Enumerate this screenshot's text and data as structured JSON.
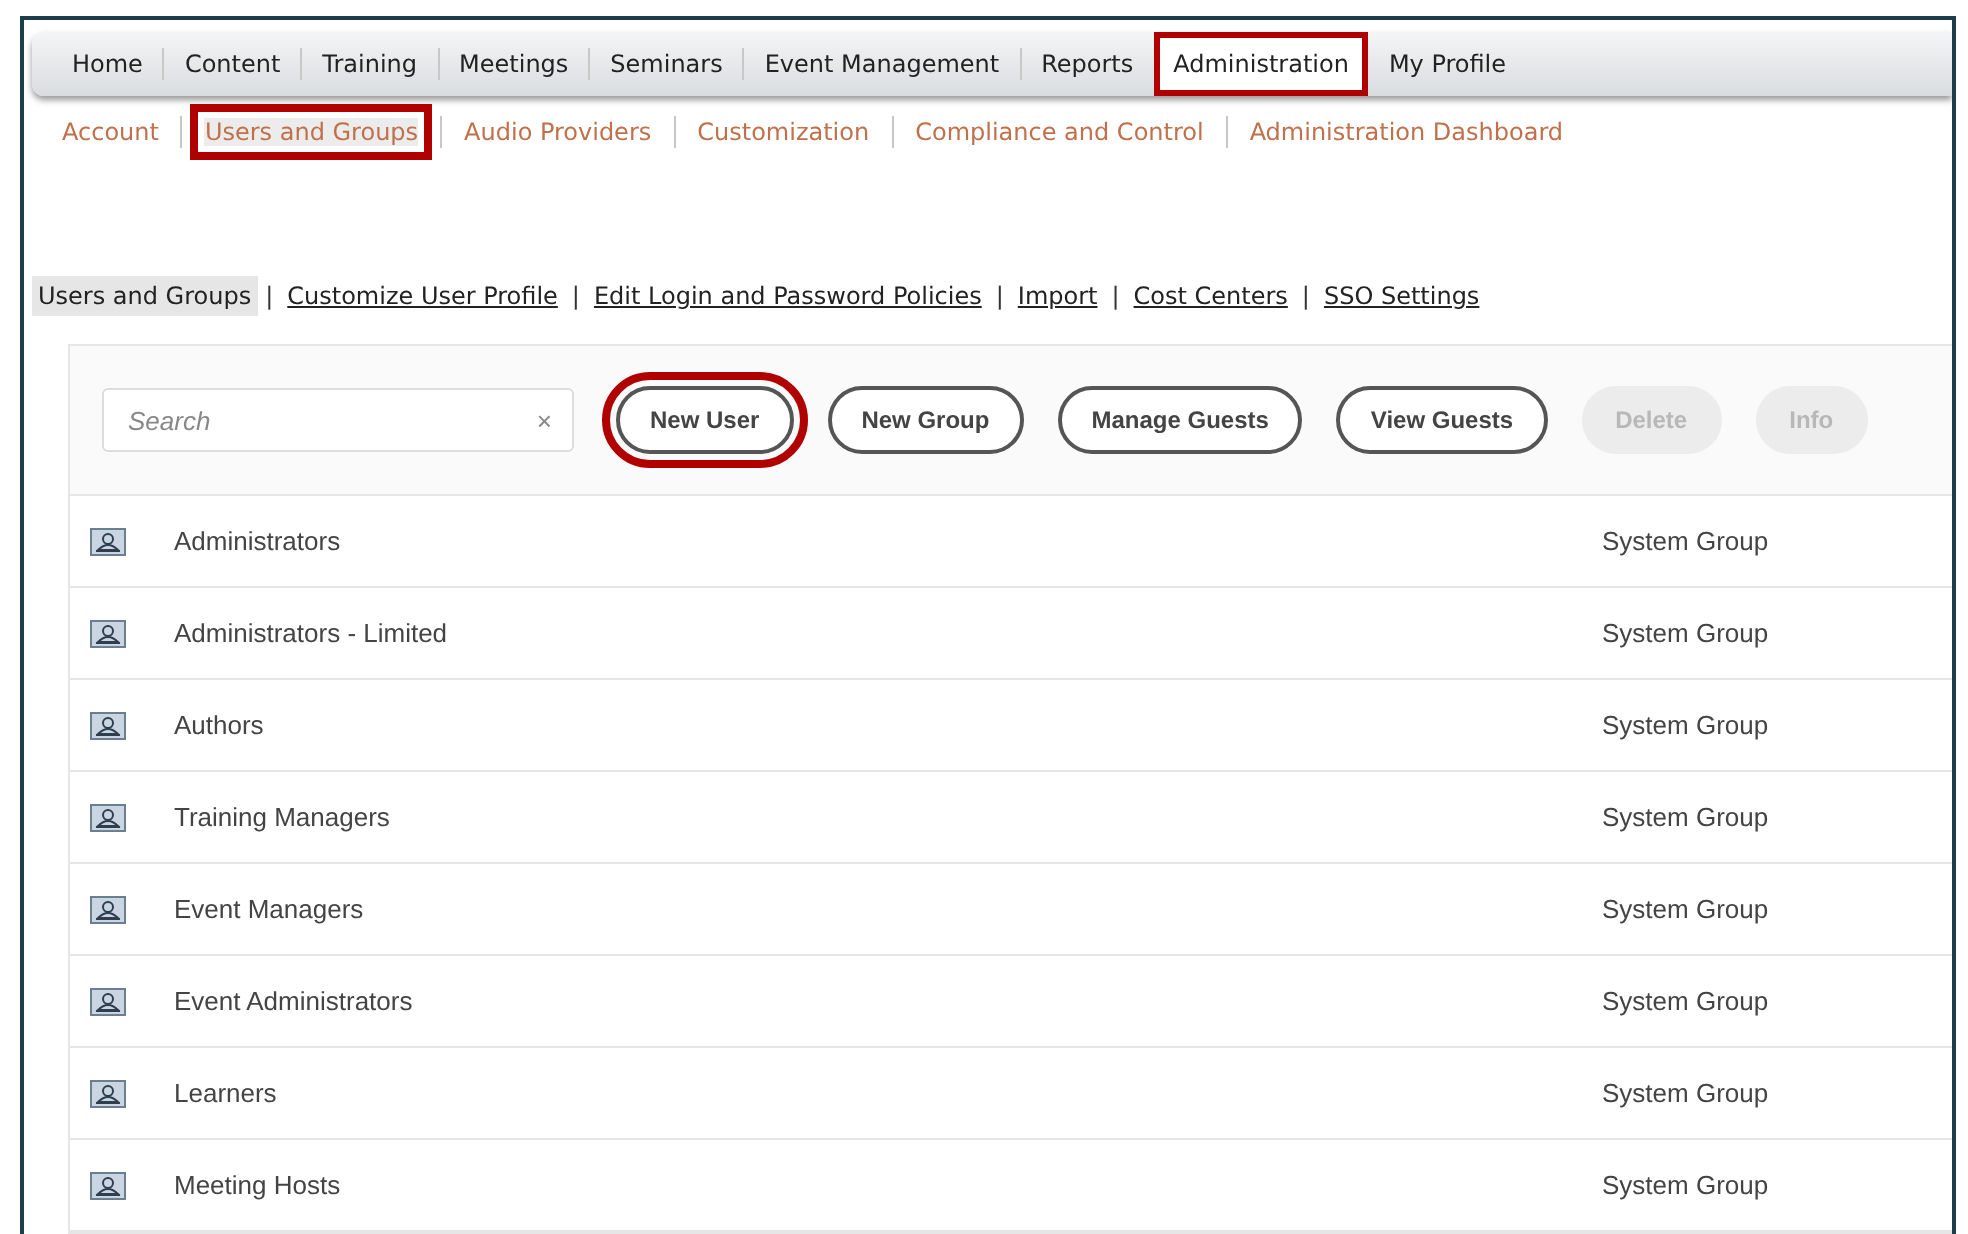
{
  "main_tabs": [
    {
      "label": "Home",
      "selected": false,
      "highlighted": false
    },
    {
      "label": "Content",
      "selected": false,
      "highlighted": false
    },
    {
      "label": "Training",
      "selected": false,
      "highlighted": false
    },
    {
      "label": "Meetings",
      "selected": false,
      "highlighted": false
    },
    {
      "label": "Seminars",
      "selected": false,
      "highlighted": false
    },
    {
      "label": "Event Management",
      "selected": false,
      "highlighted": false
    },
    {
      "label": "Reports",
      "selected": false,
      "highlighted": false
    },
    {
      "label": "Administration",
      "selected": true,
      "highlighted": true
    },
    {
      "label": "My Profile",
      "selected": false,
      "highlighted": false
    }
  ],
  "sub_tabs": [
    {
      "label": "Account",
      "selected": false,
      "highlighted": false
    },
    {
      "label": "Users and Groups",
      "selected": true,
      "highlighted": true
    },
    {
      "label": "Audio Providers",
      "selected": false,
      "highlighted": false
    },
    {
      "label": "Customization",
      "selected": false,
      "highlighted": false
    },
    {
      "label": "Compliance and Control",
      "selected": false,
      "highlighted": false
    },
    {
      "label": "Administration Dashboard",
      "selected": false,
      "highlighted": false
    }
  ],
  "section_links": [
    {
      "label": "Users and Groups",
      "selected": true
    },
    {
      "label": "Customize User Profile",
      "selected": false
    },
    {
      "label": "Edit Login and Password Policies",
      "selected": false
    },
    {
      "label": "Import",
      "selected": false
    },
    {
      "label": "Cost Centers",
      "selected": false
    },
    {
      "label": "SSO Settings",
      "selected": false
    }
  ],
  "separator": "|",
  "search": {
    "placeholder": "Search",
    "clear": "×"
  },
  "buttons": [
    {
      "label": "New User",
      "disabled": false,
      "highlighted": true
    },
    {
      "label": "New Group",
      "disabled": false,
      "highlighted": false
    },
    {
      "label": "Manage Guests",
      "disabled": false,
      "highlighted": false
    },
    {
      "label": "View Guests",
      "disabled": false,
      "highlighted": false
    },
    {
      "label": "Delete",
      "disabled": true,
      "highlighted": false
    },
    {
      "label": "Info",
      "disabled": true,
      "highlighted": false
    }
  ],
  "groups": [
    {
      "name": "Administrators",
      "type": "System Group"
    },
    {
      "name": "Administrators - Limited",
      "type": "System Group"
    },
    {
      "name": "Authors",
      "type": "System Group"
    },
    {
      "name": "Training Managers",
      "type": "System Group"
    },
    {
      "name": "Event Managers",
      "type": "System Group"
    },
    {
      "name": "Event Administrators",
      "type": "System Group"
    },
    {
      "name": "Learners",
      "type": "System Group"
    },
    {
      "name": "Meeting Hosts",
      "type": "System Group"
    }
  ]
}
